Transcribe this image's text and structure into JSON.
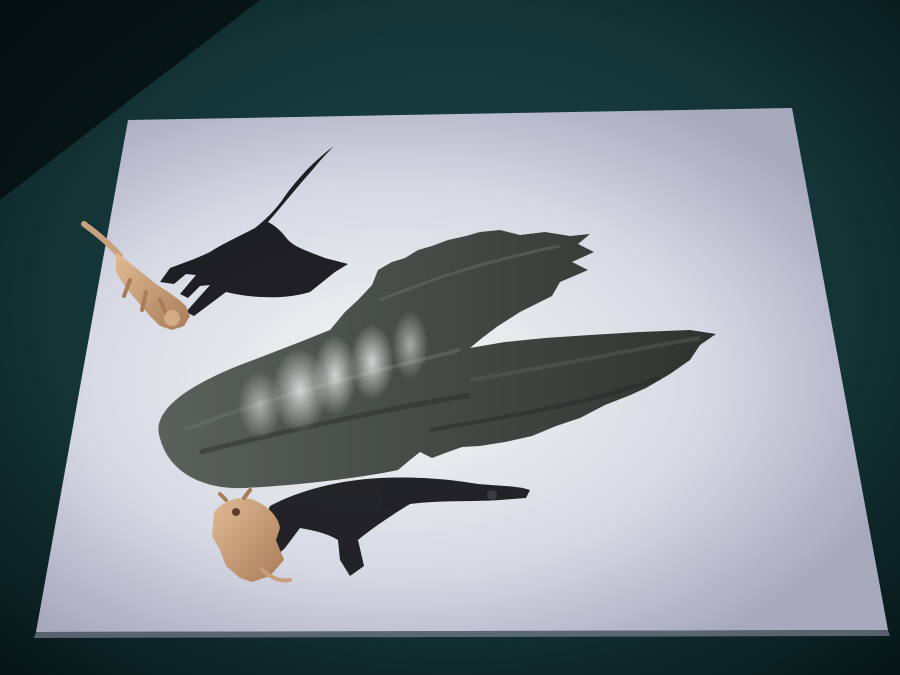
{
  "image": {
    "subject": "shadow-play",
    "colors": {
      "table_center": "#1f4a4c",
      "table_edge": "#061416",
      "paper_lit": "#f3f6f4",
      "paper_mid": "#d6d8e4",
      "paper_edge": "#a7a9bd",
      "paint": "#3c433f",
      "shadow": "#0e0e12",
      "figurine": "#c8a07c"
    },
    "objects": [
      {
        "name": "table-surface"
      },
      {
        "name": "paper-sheet"
      },
      {
        "name": "painted-wing-stroke"
      },
      {
        "name": "cat-shadow"
      },
      {
        "name": "cat-figurine"
      },
      {
        "name": "rat-shadow"
      },
      {
        "name": "rat-figurine"
      }
    ]
  }
}
